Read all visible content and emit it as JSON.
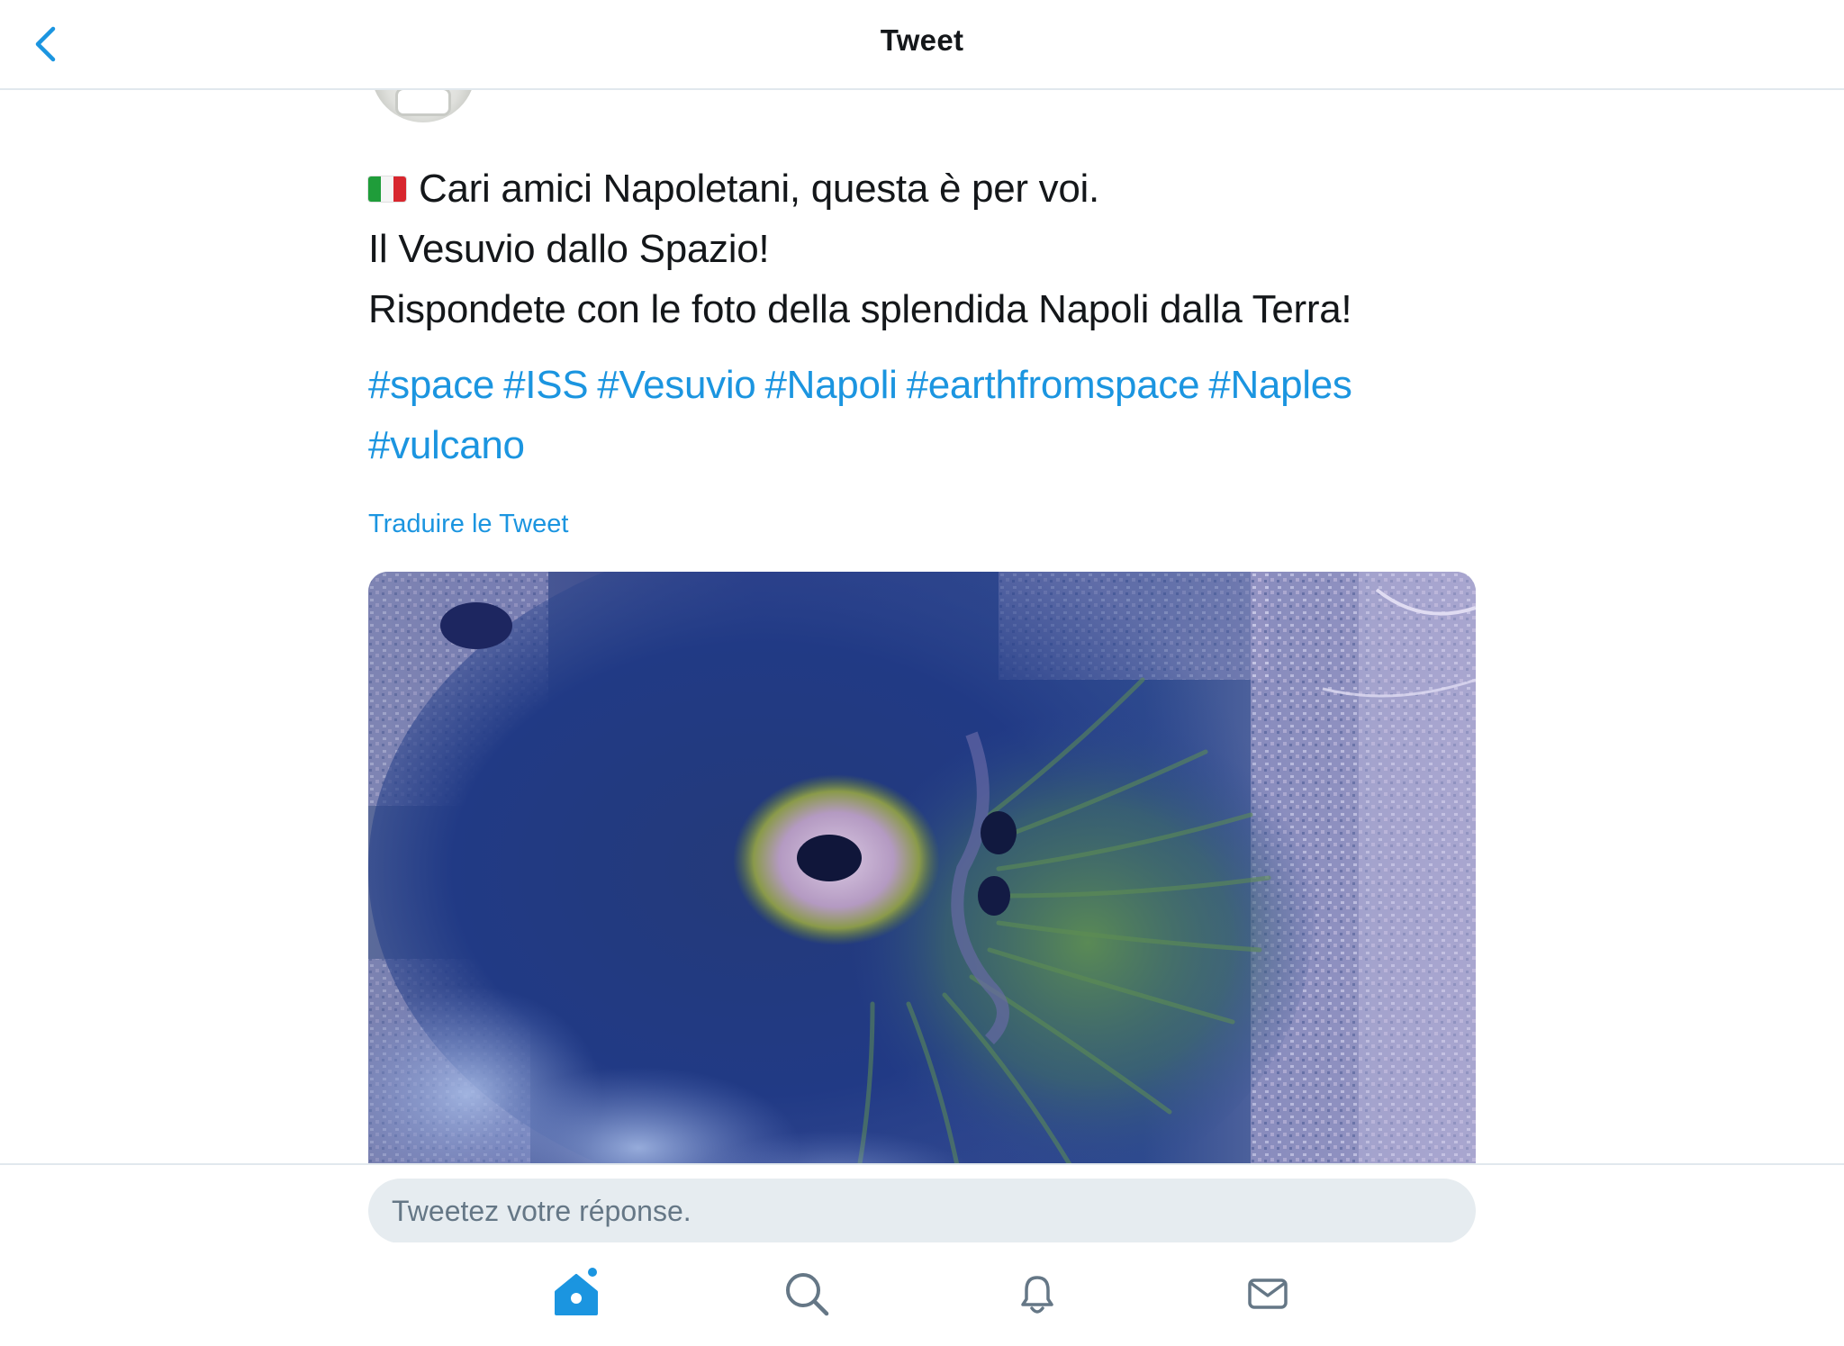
{
  "header": {
    "title": "Tweet",
    "back_icon": "chevron-left-icon"
  },
  "tweet": {
    "lines": [
      "Cari amici Napoletani, questa è per voi.",
      "Il Vesuvio dallo Spazio!",
      "Rispondete con le foto della splendida Napoli dalla Terra!"
    ],
    "flag_icon": "italy-flag-icon",
    "hashtags": [
      "#space",
      "#ISS",
      "#Vesuvio",
      "#Napoli",
      "#earthfromspace",
      "#Naples",
      "#vulcano"
    ],
    "translate_label": "Traduire le Tweet",
    "media": "satellite photo of Mount Vesuvius crater"
  },
  "reply": {
    "placeholder": "Tweetez votre réponse."
  },
  "tabbar": {
    "items": [
      {
        "name": "home",
        "icon": "home-icon",
        "active": true,
        "notification_dot": true
      },
      {
        "name": "search",
        "icon": "search-icon",
        "active": false
      },
      {
        "name": "notifications",
        "icon": "bell-icon",
        "active": false
      },
      {
        "name": "messages",
        "icon": "mail-icon",
        "active": false
      }
    ]
  },
  "colors": {
    "accent": "#1b95e0",
    "icon_gray": "#657786",
    "text": "#14171a",
    "divider": "#e1e8ed",
    "input_bg": "#e6ecf0"
  }
}
